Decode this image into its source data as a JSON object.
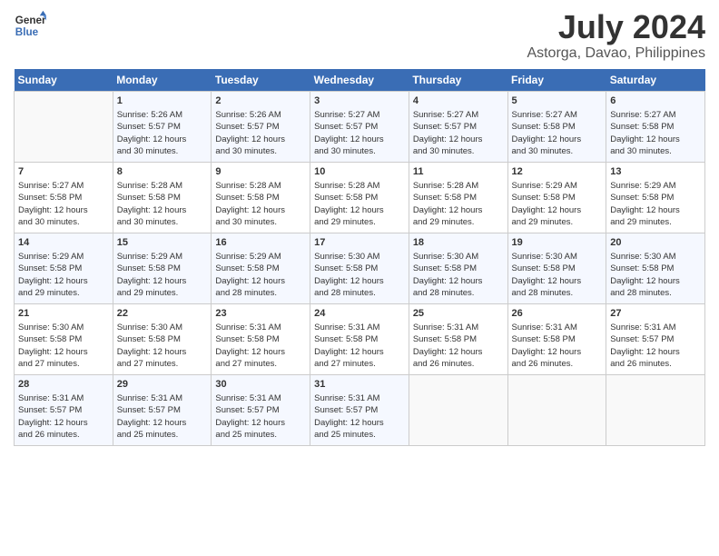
{
  "header": {
    "logo_text_line1": "General",
    "logo_text_line2": "Blue",
    "month_year": "July 2024",
    "location": "Astorga, Davao, Philippines"
  },
  "days_of_week": [
    "Sunday",
    "Monday",
    "Tuesday",
    "Wednesday",
    "Thursday",
    "Friday",
    "Saturday"
  ],
  "weeks": [
    {
      "days": [
        {
          "num": "",
          "content": ""
        },
        {
          "num": "1",
          "content": "Sunrise: 5:26 AM\nSunset: 5:57 PM\nDaylight: 12 hours\nand 30 minutes."
        },
        {
          "num": "2",
          "content": "Sunrise: 5:26 AM\nSunset: 5:57 PM\nDaylight: 12 hours\nand 30 minutes."
        },
        {
          "num": "3",
          "content": "Sunrise: 5:27 AM\nSunset: 5:57 PM\nDaylight: 12 hours\nand 30 minutes."
        },
        {
          "num": "4",
          "content": "Sunrise: 5:27 AM\nSunset: 5:57 PM\nDaylight: 12 hours\nand 30 minutes."
        },
        {
          "num": "5",
          "content": "Sunrise: 5:27 AM\nSunset: 5:58 PM\nDaylight: 12 hours\nand 30 minutes."
        },
        {
          "num": "6",
          "content": "Sunrise: 5:27 AM\nSunset: 5:58 PM\nDaylight: 12 hours\nand 30 minutes."
        }
      ]
    },
    {
      "days": [
        {
          "num": "7",
          "content": "Sunrise: 5:27 AM\nSunset: 5:58 PM\nDaylight: 12 hours\nand 30 minutes."
        },
        {
          "num": "8",
          "content": "Sunrise: 5:28 AM\nSunset: 5:58 PM\nDaylight: 12 hours\nand 30 minutes."
        },
        {
          "num": "9",
          "content": "Sunrise: 5:28 AM\nSunset: 5:58 PM\nDaylight: 12 hours\nand 30 minutes."
        },
        {
          "num": "10",
          "content": "Sunrise: 5:28 AM\nSunset: 5:58 PM\nDaylight: 12 hours\nand 29 minutes."
        },
        {
          "num": "11",
          "content": "Sunrise: 5:28 AM\nSunset: 5:58 PM\nDaylight: 12 hours\nand 29 minutes."
        },
        {
          "num": "12",
          "content": "Sunrise: 5:29 AM\nSunset: 5:58 PM\nDaylight: 12 hours\nand 29 minutes."
        },
        {
          "num": "13",
          "content": "Sunrise: 5:29 AM\nSunset: 5:58 PM\nDaylight: 12 hours\nand 29 minutes."
        }
      ]
    },
    {
      "days": [
        {
          "num": "14",
          "content": "Sunrise: 5:29 AM\nSunset: 5:58 PM\nDaylight: 12 hours\nand 29 minutes."
        },
        {
          "num": "15",
          "content": "Sunrise: 5:29 AM\nSunset: 5:58 PM\nDaylight: 12 hours\nand 29 minutes."
        },
        {
          "num": "16",
          "content": "Sunrise: 5:29 AM\nSunset: 5:58 PM\nDaylight: 12 hours\nand 28 minutes."
        },
        {
          "num": "17",
          "content": "Sunrise: 5:30 AM\nSunset: 5:58 PM\nDaylight: 12 hours\nand 28 minutes."
        },
        {
          "num": "18",
          "content": "Sunrise: 5:30 AM\nSunset: 5:58 PM\nDaylight: 12 hours\nand 28 minutes."
        },
        {
          "num": "19",
          "content": "Sunrise: 5:30 AM\nSunset: 5:58 PM\nDaylight: 12 hours\nand 28 minutes."
        },
        {
          "num": "20",
          "content": "Sunrise: 5:30 AM\nSunset: 5:58 PM\nDaylight: 12 hours\nand 28 minutes."
        }
      ]
    },
    {
      "days": [
        {
          "num": "21",
          "content": "Sunrise: 5:30 AM\nSunset: 5:58 PM\nDaylight: 12 hours\nand 27 minutes."
        },
        {
          "num": "22",
          "content": "Sunrise: 5:30 AM\nSunset: 5:58 PM\nDaylight: 12 hours\nand 27 minutes."
        },
        {
          "num": "23",
          "content": "Sunrise: 5:31 AM\nSunset: 5:58 PM\nDaylight: 12 hours\nand 27 minutes."
        },
        {
          "num": "24",
          "content": "Sunrise: 5:31 AM\nSunset: 5:58 PM\nDaylight: 12 hours\nand 27 minutes."
        },
        {
          "num": "25",
          "content": "Sunrise: 5:31 AM\nSunset: 5:58 PM\nDaylight: 12 hours\nand 26 minutes."
        },
        {
          "num": "26",
          "content": "Sunrise: 5:31 AM\nSunset: 5:58 PM\nDaylight: 12 hours\nand 26 minutes."
        },
        {
          "num": "27",
          "content": "Sunrise: 5:31 AM\nSunset: 5:57 PM\nDaylight: 12 hours\nand 26 minutes."
        }
      ]
    },
    {
      "days": [
        {
          "num": "28",
          "content": "Sunrise: 5:31 AM\nSunset: 5:57 PM\nDaylight: 12 hours\nand 26 minutes."
        },
        {
          "num": "29",
          "content": "Sunrise: 5:31 AM\nSunset: 5:57 PM\nDaylight: 12 hours\nand 25 minutes."
        },
        {
          "num": "30",
          "content": "Sunrise: 5:31 AM\nSunset: 5:57 PM\nDaylight: 12 hours\nand 25 minutes."
        },
        {
          "num": "31",
          "content": "Sunrise: 5:31 AM\nSunset: 5:57 PM\nDaylight: 12 hours\nand 25 minutes."
        },
        {
          "num": "",
          "content": ""
        },
        {
          "num": "",
          "content": ""
        },
        {
          "num": "",
          "content": ""
        }
      ]
    }
  ]
}
